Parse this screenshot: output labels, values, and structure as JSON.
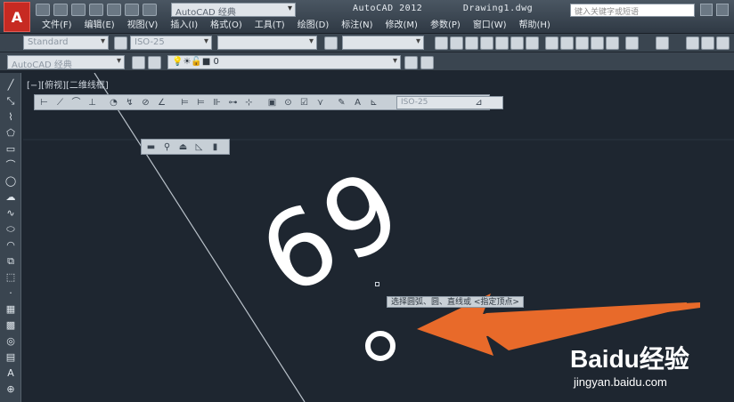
{
  "title_bar": {
    "app_title": "AutoCAD 2012",
    "document_title": "Drawing1.dwg",
    "workspace_combo": "AutoCAD 经典",
    "search_placeholder": "键入关键字或短语"
  },
  "menu": [
    "文件(F)",
    "编辑(E)",
    "视图(V)",
    "插入(I)",
    "格式(O)",
    "工具(T)",
    "绘图(D)",
    "标注(N)",
    "修改(M)",
    "参数(P)",
    "窗口(W)",
    "帮助(H)"
  ],
  "toolbar_row1": {
    "text_style": "Standard",
    "dim_style": "ISO-25"
  },
  "toolbar_row2": {
    "workspace": "AutoCAD 经典",
    "layer": "0"
  },
  "viewport_label": "[−][俯视][二维线框]",
  "dimension_toolbar": {
    "style_combo": "ISO-25"
  },
  "drawing": {
    "text": "69",
    "tooltip": "选择圆弧、圆、直线或 <指定顶点>"
  },
  "watermark": {
    "brand": "Baidu经验",
    "url": "jingyan.baidu.com"
  },
  "colors": {
    "canvas": "#1e2630",
    "arrow": "#e86a2a",
    "toolbar": "#3a4550"
  }
}
